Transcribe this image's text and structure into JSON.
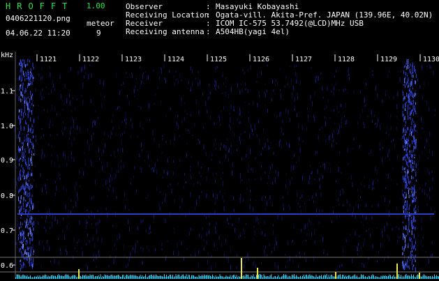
{
  "app": {
    "name": "HROFFT",
    "version": "1.00"
  },
  "file": {
    "name": "0406221120.png",
    "timestamp": "04.06.22 11:20"
  },
  "meteor": {
    "label": "meteor",
    "count": "9"
  },
  "meta": [
    {
      "key": "Observer",
      "value": "Masayuki Kobayashi"
    },
    {
      "key": "Receiving Location",
      "value": "Ogata-vill. Akita-Pref. JAPAN (139.96E, 40.02N)"
    },
    {
      "key": "Receiver",
      "value": "ICOM IC-575 53.7492(@LCD)MHz USB"
    },
    {
      "key": "Receiving antenna",
      "value": "A504HB(yagi 4el)"
    }
  ],
  "axes": {
    "y_unit": "kHz",
    "y_ticks": [
      "1.1",
      "1.0",
      "0.9",
      "0.8",
      "0.7",
      "0.6"
    ],
    "x_ticks": [
      "1121",
      "1122",
      "1123",
      "1124",
      "1125",
      "1126",
      "1127",
      "1128",
      "1129",
      "1130"
    ]
  },
  "colors": {
    "background": "#000000",
    "title": "#2ee04f",
    "text": "#ffffff",
    "spectrum": "#1a1f8a",
    "trace": "#3fd6ff",
    "event": "#e8e84a"
  }
}
